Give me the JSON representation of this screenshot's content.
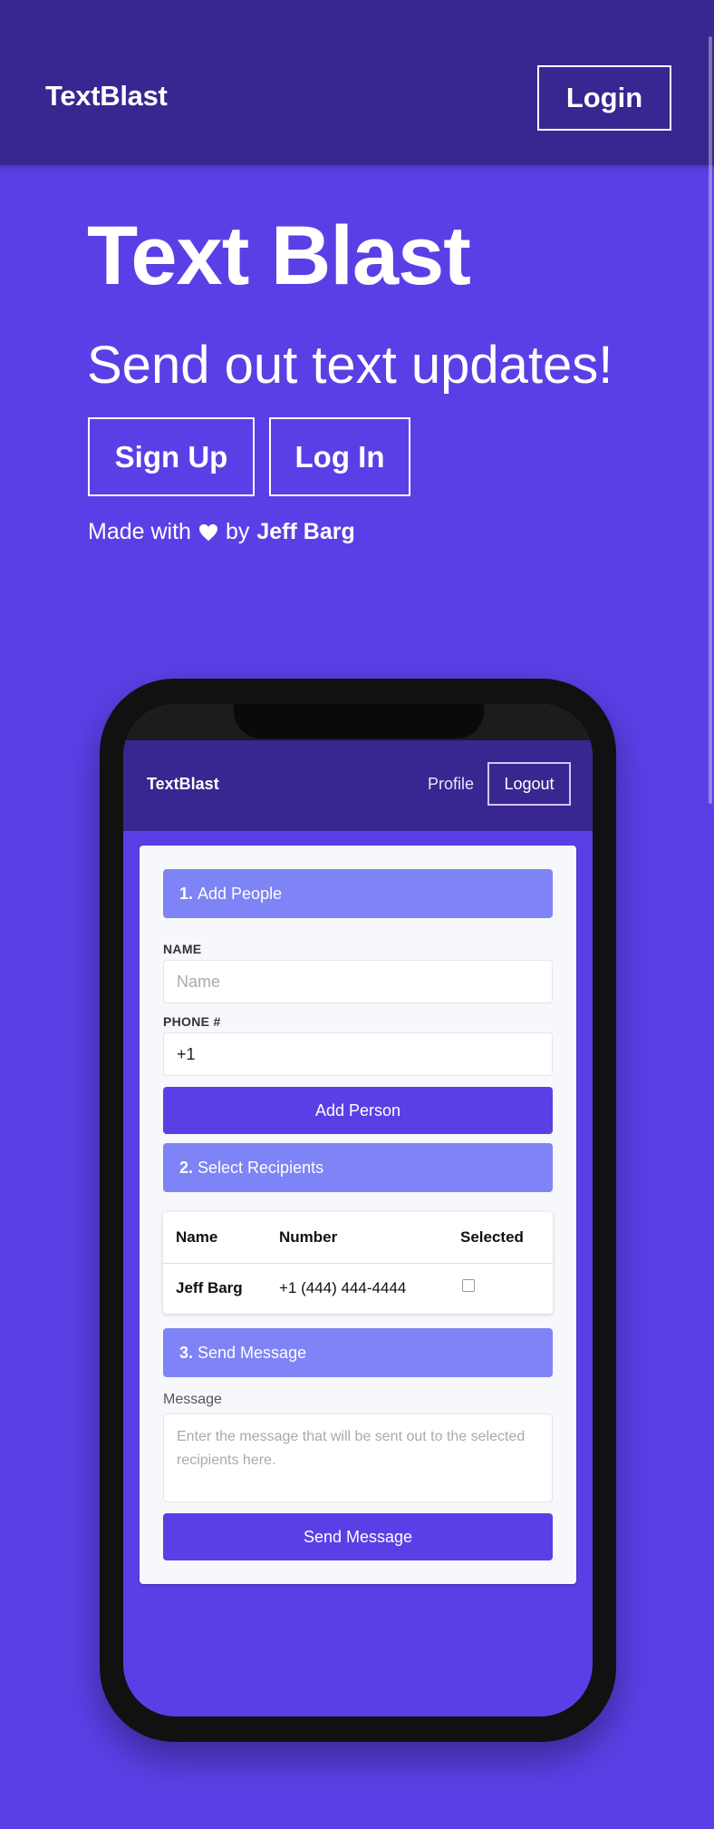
{
  "topbar": {
    "brand": "TextBlast",
    "login_label": "Login"
  },
  "hero": {
    "title": "Text Blast",
    "subtitle": "Send out text updates!",
    "signup_label": "Sign Up",
    "login_label": "Log In",
    "credit_prefix": "Made with",
    "credit_by": "by",
    "credit_author": "Jeff Barg"
  },
  "app": {
    "brand": "TextBlast",
    "profile_label": "Profile",
    "logout_label": "Logout",
    "section1": {
      "num": "1.",
      "label": "Add People"
    },
    "name_label": "NAME",
    "name_placeholder": "Name",
    "phone_label": "PHONE #",
    "phone_value": "+1",
    "add_person_label": "Add Person",
    "section2": {
      "num": "2.",
      "label": "Select Recipients"
    },
    "table": {
      "headers": [
        "Name",
        "Number",
        "Selected"
      ],
      "rows": [
        {
          "name": "Jeff Barg",
          "number": "+1 (444) 444-4444",
          "selected": false
        }
      ]
    },
    "section3": {
      "num": "3.",
      "label": "Send Message"
    },
    "message_label": "Message",
    "message_placeholder": "Enter the message that will be sent out to the selected recipients here.",
    "send_label": "Send Message"
  }
}
